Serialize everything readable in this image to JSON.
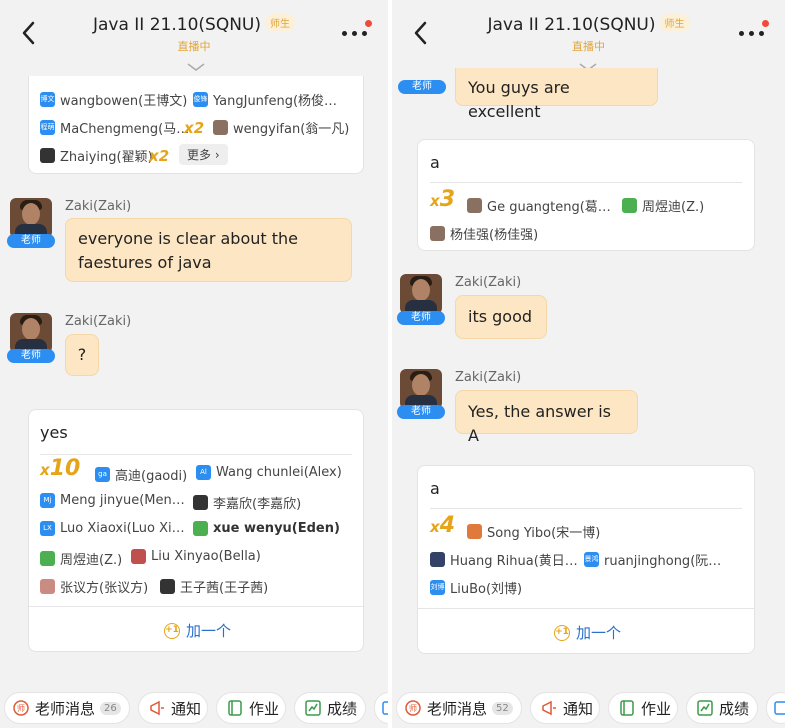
{
  "left": {
    "header": {
      "title": "Java II  21.10(SQNU)",
      "role": "师生",
      "status": "直播中"
    },
    "top_card": {
      "users": [
        {
          "name": "wangbowen(王博文)",
          "avatar": "博文"
        },
        {
          "name": "YangJunfeng(杨俊…",
          "avatar": "俊锋"
        },
        {
          "name": "MaChengmeng(马…",
          "avatar": "程萌"
        },
        {
          "name": "wengyifan(翁一凡)",
          "avatar": ""
        },
        {
          "name": "Zhaiying(翟颖)",
          "avatar": ""
        }
      ],
      "count_x": "x",
      "count_2a": "2",
      "count_2b": "2",
      "more_label": "更多"
    },
    "msg1": {
      "sender": "Zaki(Zaki)",
      "badge": "老师",
      "line1": "everyone is clear about the",
      "line2": "faestures of java"
    },
    "msg2": {
      "sender": "Zaki(Zaki)",
      "badge": "老师",
      "text": "?"
    },
    "qa": {
      "title": "yes",
      "count_x": "x",
      "count_n": "10",
      "users": [
        {
          "name": "高迪(gaodi)",
          "avatar": "ga"
        },
        {
          "name": "Wang chunlei(Alex)",
          "avatar": "Al"
        },
        {
          "name": "Meng jinyue(Men…",
          "avatar": "Mj"
        },
        {
          "name": "李嘉欣(李嘉欣)",
          "avatar": ""
        },
        {
          "name": "Luo Xiaoxi(Luo Xi…",
          "avatar": "LX"
        },
        {
          "name": "xue wenyu(Eden)",
          "avatar": ""
        },
        {
          "name": "周煜迪(Z.)",
          "avatar": ""
        },
        {
          "name": "Liu Xinyao(Bella)",
          "avatar": ""
        },
        {
          "name": "张议方(张议方)",
          "avatar": ""
        },
        {
          "name": "王子茜(王子茜)",
          "avatar": ""
        }
      ],
      "add_label": "加一个",
      "add_icon": "+1"
    },
    "bottom": {
      "teacher_msg": "老师消息",
      "teacher_count": "26",
      "notice": "通知",
      "homework": "作业",
      "grades": "成绩"
    }
  },
  "right": {
    "header": {
      "title": "Java II  21.10(SQNU)",
      "role": "师生",
      "status": "直播中"
    },
    "msg0": {
      "badge": "老师",
      "text": "You guys are excellent"
    },
    "qa1": {
      "title": "a",
      "count_x": "x",
      "count_n": "3",
      "users": [
        {
          "name": "Ge guangteng(葛…",
          "avatar": ""
        },
        {
          "name": "周煜迪(Z.)",
          "avatar": ""
        },
        {
          "name": "杨佳强(杨佳强)",
          "avatar": ""
        }
      ]
    },
    "msg1": {
      "sender": "Zaki(Zaki)",
      "badge": "老师",
      "text": "its good"
    },
    "msg2": {
      "sender": "Zaki(Zaki)",
      "badge": "老师",
      "text": "Yes, the answer is A"
    },
    "qa2": {
      "title": "a",
      "count_x": "x",
      "count_n": "4",
      "users": [
        {
          "name": "Song Yibo(宋一博)",
          "avatar": ""
        },
        {
          "name": "Huang Rihua(黄日…",
          "avatar": ""
        },
        {
          "name": "ruanjinghong(阮…",
          "avatar": "景鸿"
        },
        {
          "name": "LiuBo(刘博)",
          "avatar": "刘博"
        }
      ],
      "add_label": "加一个",
      "add_icon": "+1"
    },
    "bottom": {
      "teacher_msg": "老师消息",
      "teacher_count": "52",
      "notice": "通知",
      "homework": "作业",
      "grades": "成绩"
    }
  },
  "colors": {
    "accent": "#2b8ef0",
    "bubble": "#fde6c4",
    "count": "#e6a519",
    "live": "#e0a53a"
  }
}
